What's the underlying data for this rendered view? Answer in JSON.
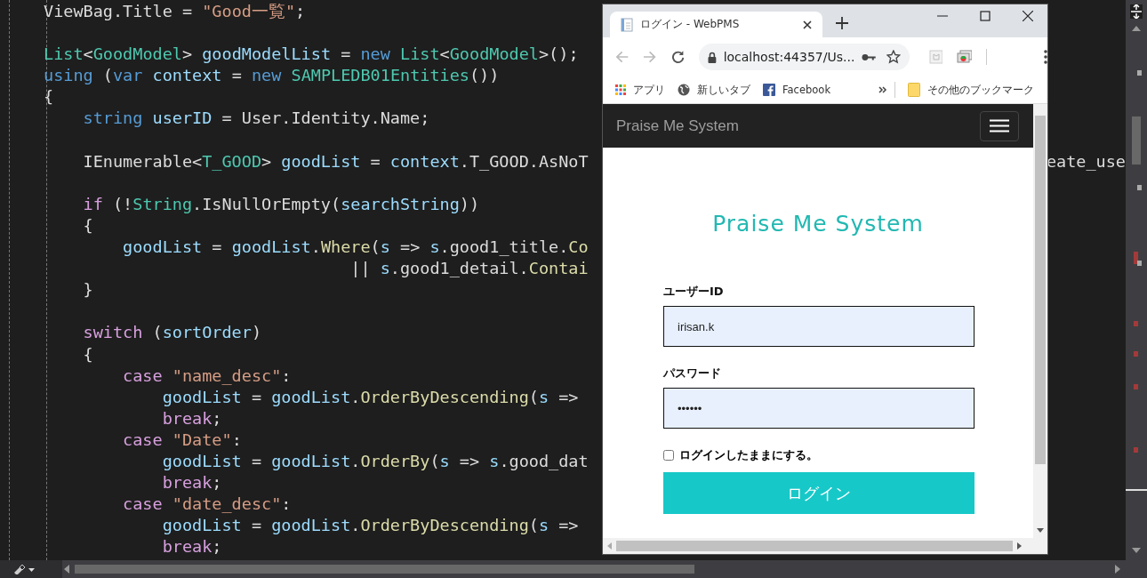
{
  "editor": {
    "lines": [
      {
        "kind": "code",
        "tokens": [
          {
            "text": "ViewBag.Title = ",
            "kind": "plain"
          },
          {
            "text": "\"Good一覧\"",
            "kind": "string"
          },
          {
            "text": ";",
            "kind": "plain"
          }
        ]
      },
      {
        "kind": "blank"
      },
      {
        "kind": "code",
        "tokens": [
          {
            "text": "List",
            "kind": "type"
          },
          {
            "text": "<",
            "kind": "plain"
          },
          {
            "text": "GoodModel",
            "kind": "type"
          },
          {
            "text": "> ",
            "kind": "plain"
          },
          {
            "text": "goodModelList",
            "kind": "ident"
          },
          {
            "text": " = ",
            "kind": "plain"
          },
          {
            "text": "new ",
            "kind": "keyword"
          },
          {
            "text": "List",
            "kind": "type"
          },
          {
            "text": "<",
            "kind": "plain"
          },
          {
            "text": "GoodModel",
            "kind": "type"
          },
          {
            "text": ">();",
            "kind": "plain"
          }
        ]
      },
      {
        "kind": "code",
        "tokens": [
          {
            "text": "using",
            "kind": "keyword"
          },
          {
            "text": " (",
            "kind": "plain"
          },
          {
            "text": "var ",
            "kind": "keyword"
          },
          {
            "text": "context",
            "kind": "ident"
          },
          {
            "text": " = ",
            "kind": "plain"
          },
          {
            "text": "new ",
            "kind": "keyword"
          },
          {
            "text": "SAMPLEDB01Entities",
            "kind": "type"
          },
          {
            "text": "())",
            "kind": "plain"
          }
        ]
      },
      {
        "kind": "code",
        "tokens": [
          {
            "text": "{",
            "kind": "plain"
          }
        ]
      },
      {
        "kind": "code",
        "tokens": [
          {
            "text": "    string ",
            "kind": "keyword"
          },
          {
            "text": "userID",
            "kind": "ident"
          },
          {
            "text": " = User.Identity.Name;",
            "kind": "plain"
          }
        ]
      },
      {
        "kind": "blank"
      },
      {
        "kind": "code",
        "tokens": [
          {
            "text": "    IEnumerable<",
            "kind": "plain"
          },
          {
            "text": "T_GOOD",
            "kind": "type"
          },
          {
            "text": "> ",
            "kind": "plain"
          },
          {
            "text": "goodList",
            "kind": "ident"
          },
          {
            "text": " = ",
            "kind": "plain"
          },
          {
            "text": "context",
            "kind": "ident"
          },
          {
            "text": ".T_GOOD.AsNoT",
            "kind": "plain"
          }
        ],
        "right_part": "eate_use"
      },
      {
        "kind": "blank"
      },
      {
        "kind": "code",
        "tokens": [
          {
            "text": "    if",
            "kind": "control"
          },
          {
            "text": " (!",
            "kind": "plain"
          },
          {
            "text": "String",
            "kind": "type"
          },
          {
            "text": ".IsNullOrEmpty(",
            "kind": "plain"
          },
          {
            "text": "searchString",
            "kind": "ident"
          },
          {
            "text": "))",
            "kind": "plain"
          }
        ]
      },
      {
        "kind": "code",
        "tokens": [
          {
            "text": "    {",
            "kind": "plain"
          }
        ]
      },
      {
        "kind": "code",
        "tokens": [
          {
            "text": "        goodList",
            "kind": "ident"
          },
          {
            "text": " = ",
            "kind": "plain"
          },
          {
            "text": "goodList",
            "kind": "ident"
          },
          {
            "text": ".",
            "kind": "plain"
          },
          {
            "text": "Where",
            "kind": "method"
          },
          {
            "text": "(",
            "kind": "plain"
          },
          {
            "text": "s",
            "kind": "ident"
          },
          {
            "text": " => ",
            "kind": "plain"
          },
          {
            "text": "s",
            "kind": "ident"
          },
          {
            "text": ".good1_title.",
            "kind": "plain"
          },
          {
            "text": "Co",
            "kind": "method"
          }
        ]
      },
      {
        "kind": "code",
        "tokens": [
          {
            "text": "                               || ",
            "kind": "plain"
          },
          {
            "text": "s",
            "kind": "ident"
          },
          {
            "text": ".good1_detail.",
            "kind": "plain"
          },
          {
            "text": "Contai",
            "kind": "method"
          }
        ]
      },
      {
        "kind": "code",
        "tokens": [
          {
            "text": "    }",
            "kind": "plain"
          }
        ]
      },
      {
        "kind": "blank"
      },
      {
        "kind": "code",
        "tokens": [
          {
            "text": "    switch",
            "kind": "control"
          },
          {
            "text": " (",
            "kind": "plain"
          },
          {
            "text": "sortOrder",
            "kind": "ident"
          },
          {
            "text": ")",
            "kind": "plain"
          }
        ]
      },
      {
        "kind": "code",
        "tokens": [
          {
            "text": "    {",
            "kind": "plain"
          }
        ]
      },
      {
        "kind": "code",
        "tokens": [
          {
            "text": "        case ",
            "kind": "control"
          },
          {
            "text": "\"name_desc\"",
            "kind": "string"
          },
          {
            "text": ":",
            "kind": "plain"
          }
        ]
      },
      {
        "kind": "code",
        "tokens": [
          {
            "text": "            goodList",
            "kind": "ident"
          },
          {
            "text": " = ",
            "kind": "plain"
          },
          {
            "text": "goodList",
            "kind": "ident"
          },
          {
            "text": ".",
            "kind": "plain"
          },
          {
            "text": "OrderByDescending",
            "kind": "method"
          },
          {
            "text": "(",
            "kind": "plain"
          },
          {
            "text": "s",
            "kind": "ident"
          },
          {
            "text": " =>",
            "kind": "plain"
          }
        ]
      },
      {
        "kind": "code",
        "tokens": [
          {
            "text": "            break",
            "kind": "control"
          },
          {
            "text": ";",
            "kind": "plain"
          }
        ]
      },
      {
        "kind": "code",
        "tokens": [
          {
            "text": "        case ",
            "kind": "control"
          },
          {
            "text": "\"Date\"",
            "kind": "string"
          },
          {
            "text": ":",
            "kind": "plain"
          }
        ]
      },
      {
        "kind": "code",
        "tokens": [
          {
            "text": "            goodList",
            "kind": "ident"
          },
          {
            "text": " = ",
            "kind": "plain"
          },
          {
            "text": "goodList",
            "kind": "ident"
          },
          {
            "text": ".",
            "kind": "plain"
          },
          {
            "text": "OrderBy",
            "kind": "method"
          },
          {
            "text": "(",
            "kind": "plain"
          },
          {
            "text": "s",
            "kind": "ident"
          },
          {
            "text": " => ",
            "kind": "plain"
          },
          {
            "text": "s",
            "kind": "ident"
          },
          {
            "text": ".good_dat",
            "kind": "plain"
          }
        ]
      },
      {
        "kind": "code",
        "tokens": [
          {
            "text": "            break",
            "kind": "control"
          },
          {
            "text": ";",
            "kind": "plain"
          }
        ]
      },
      {
        "kind": "code",
        "tokens": [
          {
            "text": "        case ",
            "kind": "control"
          },
          {
            "text": "\"date_desc\"",
            "kind": "string"
          },
          {
            "text": ":",
            "kind": "plain"
          }
        ]
      },
      {
        "kind": "code",
        "tokens": [
          {
            "text": "            goodList",
            "kind": "ident"
          },
          {
            "text": " = ",
            "kind": "plain"
          },
          {
            "text": "goodList",
            "kind": "ident"
          },
          {
            "text": ".",
            "kind": "plain"
          },
          {
            "text": "OrderByDescending",
            "kind": "method"
          },
          {
            "text": "(",
            "kind": "plain"
          },
          {
            "text": "s",
            "kind": "ident"
          },
          {
            "text": " =>",
            "kind": "plain"
          }
        ]
      },
      {
        "kind": "code",
        "tokens": [
          {
            "text": "            break",
            "kind": "control"
          },
          {
            "text": ";",
            "kind": "plain"
          }
        ]
      }
    ]
  },
  "browser": {
    "tabs": [
      {
        "title": "ログイン - WebPMS",
        "selected": true
      }
    ],
    "address": "localhost:44357/Us...",
    "bookmarks": [
      {
        "label": "アプリ",
        "kind": "apps"
      },
      {
        "label": "新しいタブ",
        "kind": "globe"
      },
      {
        "label": "Facebook",
        "kind": "facebook"
      }
    ],
    "other_bookmarks": "その他のブックマーク",
    "page": {
      "brand": "Praise Me System",
      "heading": "Praise Me System",
      "fields": [
        {
          "label": "ユーザーID",
          "value": "irisan.k"
        },
        {
          "label": "パスワード",
          "value": "••••••"
        }
      ],
      "remember": {
        "label": "ログインしたままにする。",
        "checked": false
      },
      "submit": "ログイン"
    }
  }
}
